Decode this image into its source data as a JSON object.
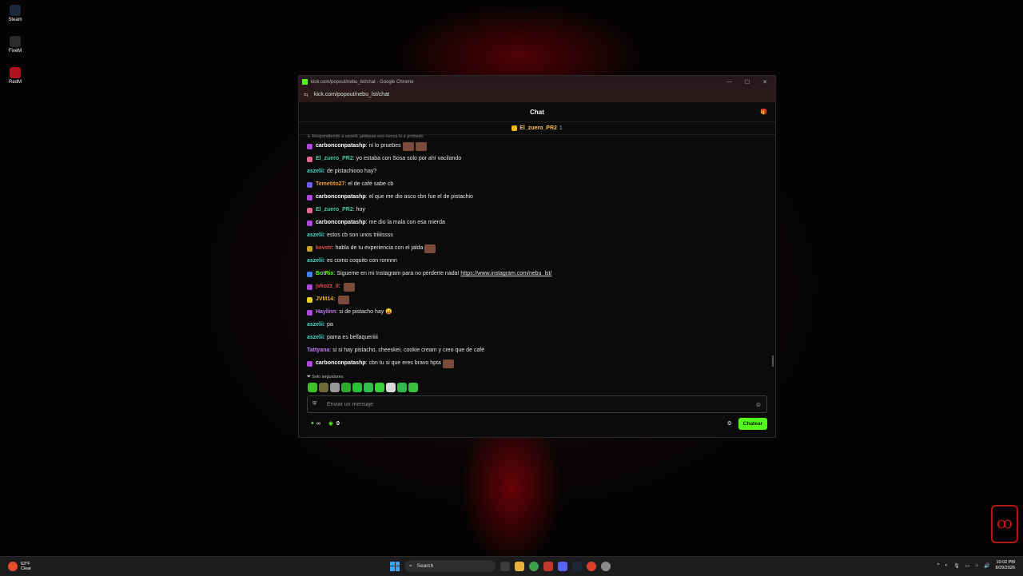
{
  "desktop": {
    "icons": [
      {
        "label": "Steam",
        "color": "#1b2838"
      },
      {
        "label": "FiveM",
        "color": "#2a2a2a"
      },
      {
        "label": "RedM",
        "color": "#b0101c"
      }
    ]
  },
  "window": {
    "title": "kick.com/popout/nebu_lst/chat - Google Chrome",
    "url": "kick.com/popout/nebu_lst/chat",
    "accent": "#53fc18"
  },
  "chat": {
    "header_title": "Chat",
    "pinned": {
      "name": "El_zuero_PR2",
      "count": "1"
    },
    "reply_context": "Respondiendo a aszelii: jaldasaa eso nunca lo e probado",
    "messages": [
      {
        "user": "carbonconpatashp",
        "color": "#ffffff",
        "text": "ni lo pruebes",
        "badge": "#b04adf",
        "emotes": 2
      },
      {
        "user": "El_zuero_PR2",
        "color": "#4ec7a3",
        "text": "yo estaba con Sosa solo por ahí vacilando",
        "badge": "#e06a8c",
        "emotes": 0
      },
      {
        "user": "aszelii",
        "color": "#4fd2c8",
        "text": "de pistachiooo hay?",
        "badge": "",
        "emotes": 0
      },
      {
        "user": "Temetito27",
        "color": "#f29a3a",
        "text": "el de café sabe cb",
        "badge": "#6e5ef0",
        "emotes": 0
      },
      {
        "user": "carbonconpatashp",
        "color": "#ffffff",
        "text": "el que me dio asco cbn fue el de pistachio",
        "badge": "#b04adf",
        "emotes": 0
      },
      {
        "user": "El_zuero_PR2",
        "color": "#4ec7a3",
        "text": "hoy",
        "badge": "#e06a8c",
        "emotes": 0
      },
      {
        "user": "carbonconpatashp",
        "color": "#ffffff",
        "text": "me dio la mala con esa mierda",
        "badge": "#b04adf",
        "emotes": 0
      },
      {
        "user": "aszelii",
        "color": "#4fd2c8",
        "text": "estos cb son unos triiiissss",
        "badge": "",
        "emotes": 0
      },
      {
        "user": "kevstr",
        "color": "#e24a4a",
        "text": "habla de tu experiencia con el jalda",
        "badge": "#c9a227",
        "emotes": 1
      },
      {
        "user": "aszelii",
        "color": "#4fd2c8",
        "text": "es como coquito con ronnnn",
        "badge": "",
        "emotes": 0
      },
      {
        "user": "BotRix",
        "color": "#53fc18",
        "text": "Sigueme en mi Instagram para no perderte nada!",
        "link": "https://www.instagram.com/nebu_lst/",
        "badge": "#3b82f6",
        "emotes": 0
      },
      {
        "user": "jvkozz_II",
        "color": "#e24a4a",
        "text": "",
        "badge": "#b04adf",
        "emotes": 1
      },
      {
        "user": "JVM14",
        "color": "#f2a43a",
        "text": "",
        "badge": "#e8d22a",
        "emotes": 1
      },
      {
        "user": "Haylinn",
        "color": "#c07cf0",
        "text": "si de pistacho hay 😛",
        "badge": "#b04adf",
        "emotes": 0
      },
      {
        "user": "aszelii",
        "color": "#4fd2c8",
        "text": "pa",
        "badge": "",
        "emotes": 0
      },
      {
        "user": "aszelii",
        "color": "#4fd2c8",
        "text": "pama es bellaqueriiii",
        "badge": "",
        "emotes": 0
      },
      {
        "user": "Tattyana",
        "color": "#c07cf0",
        "text": "si si hay pistacho, cheeskei, cookie cream y creo que de café",
        "badge": "",
        "emotes": 0
      },
      {
        "user": "carbonconpatashp",
        "color": "#ffffff",
        "text": "cbn tu si que eres bravo hpta",
        "badge": "#b04adf",
        "emotes": 1
      }
    ],
    "followers_only": "Solo seguidores",
    "input_placeholder": "Enviar un mensaje",
    "infinity_label": "∞",
    "points_value": "0",
    "send_label": "Chatear"
  },
  "taskbar": {
    "weather_temp": "63°F",
    "weather_desc": "Clear",
    "search_label": "Search",
    "time": "10:02 PM",
    "date": "8/29/2026"
  }
}
